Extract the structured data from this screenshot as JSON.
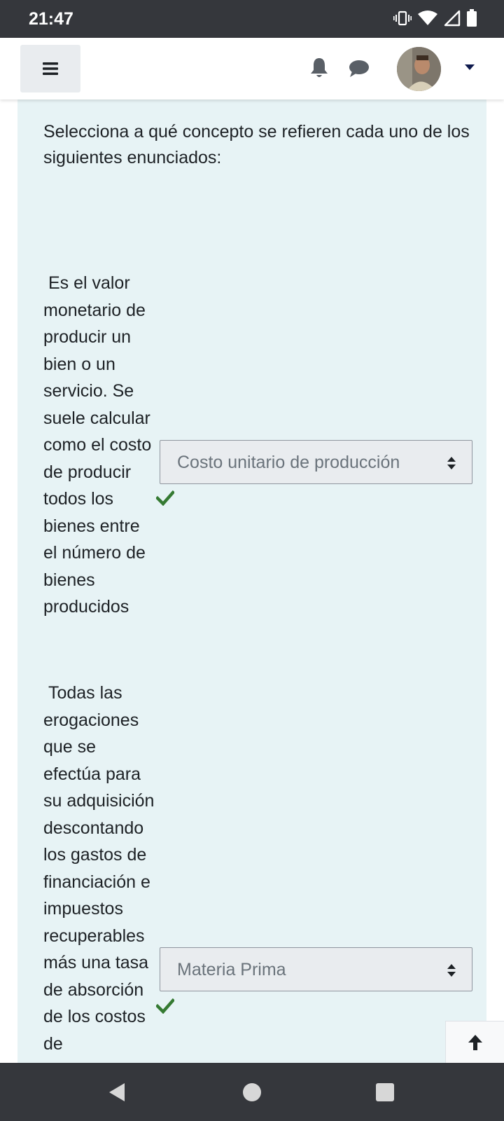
{
  "status_bar": {
    "time": "21:47",
    "icons": [
      "vibrate-icon",
      "wifi-icon",
      "signal-icon",
      "battery-icon"
    ]
  },
  "navbar": {
    "menu_icon": "hamburger-icon",
    "notifications_icon": "bell-icon",
    "messages_icon": "chat-icon",
    "user_menu_icon": "caret-down-icon"
  },
  "question": {
    "prompt": "Selecciona a qué concepto se refieren cada uno de los siguientes enunciados:",
    "rows": [
      {
        "statement": " Es el valor monetario de producir un bien o un servicio. Se suele calcular como el costo de producir todos los bienes entre el número de bienes producidos",
        "selected": "Costo unitario de producción",
        "status_icon": "check-icon"
      },
      {
        "statement": " Todas las erogaciones que se efectúa para su adquisición descontando los gastos de financiación e impuestos recuperables más una tasa de absorción de los costos de",
        "selected": "Materia Prima",
        "status_icon": "check-icon"
      }
    ]
  },
  "colors": {
    "status_bar": "#35373c",
    "content_bg": "#e7f3f5",
    "check": "#357a32",
    "caret": "#0f1a4d"
  }
}
